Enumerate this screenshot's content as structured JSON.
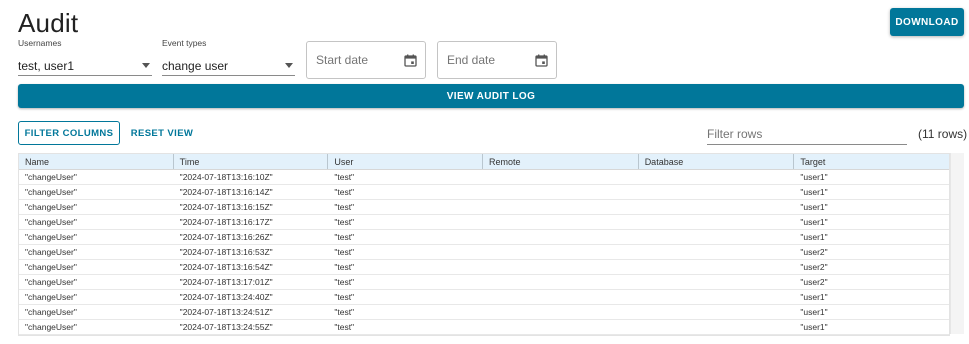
{
  "page": {
    "title": "Audit",
    "download_label": "DOWNLOAD",
    "accent_color": "#01779a"
  },
  "filters": {
    "usernames_label": "Usernames",
    "usernames_value": "test, user1",
    "event_types_label": "Event types",
    "event_types_value": "change user",
    "start_date_placeholder": "Start date",
    "end_date_placeholder": "End date",
    "view_label": "VIEW AUDIT LOG"
  },
  "toolbar": {
    "filter_columns_label": "FILTER COLUMNS",
    "reset_view_label": "RESET VIEW",
    "filter_rows_placeholder": "Filter rows",
    "row_count": "(11 rows)"
  },
  "table": {
    "columns": [
      "Name",
      "Time",
      "User",
      "Remote",
      "Database",
      "Target"
    ],
    "rows": [
      [
        "\"changeUser\"",
        "\"2024-07-18T13:16:10Z\"",
        "\"test\"",
        "",
        "",
        "\"user1\""
      ],
      [
        "\"changeUser\"",
        "\"2024-07-18T13:16:14Z\"",
        "\"test\"",
        "",
        "",
        "\"user1\""
      ],
      [
        "\"changeUser\"",
        "\"2024-07-18T13:16:15Z\"",
        "\"test\"",
        "",
        "",
        "\"user1\""
      ],
      [
        "\"changeUser\"",
        "\"2024-07-18T13:16:17Z\"",
        "\"test\"",
        "",
        "",
        "\"user1\""
      ],
      [
        "\"changeUser\"",
        "\"2024-07-18T13:16:26Z\"",
        "\"test\"",
        "",
        "",
        "\"user1\""
      ],
      [
        "\"changeUser\"",
        "\"2024-07-18T13:16:53Z\"",
        "\"test\"",
        "",
        "",
        "\"user2\""
      ],
      [
        "\"changeUser\"",
        "\"2024-07-18T13:16:54Z\"",
        "\"test\"",
        "",
        "",
        "\"user2\""
      ],
      [
        "\"changeUser\"",
        "\"2024-07-18T13:17:01Z\"",
        "\"test\"",
        "",
        "",
        "\"user2\""
      ],
      [
        "\"changeUser\"",
        "\"2024-07-18T13:24:40Z\"",
        "\"test\"",
        "",
        "",
        "\"user1\""
      ],
      [
        "\"changeUser\"",
        "\"2024-07-18T13:24:51Z\"",
        "\"test\"",
        "",
        "",
        "\"user1\""
      ],
      [
        "\"changeUser\"",
        "\"2024-07-18T13:24:55Z\"",
        "\"test\"",
        "",
        "",
        "\"user1\""
      ]
    ]
  }
}
